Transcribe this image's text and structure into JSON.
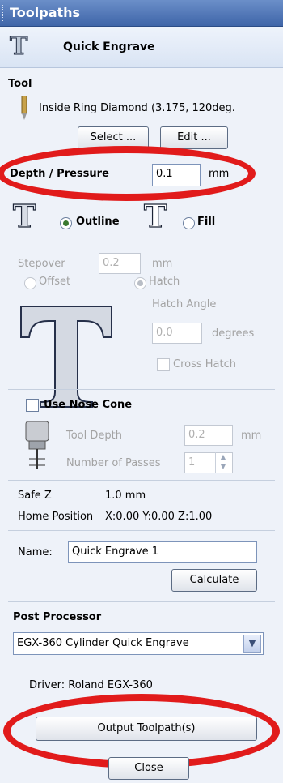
{
  "panel": {
    "title": "Toolpaths"
  },
  "header": {
    "title": "Quick Engrave",
    "icon": "engrave-T-icon"
  },
  "tool": {
    "heading": "Tool",
    "name": "Inside Ring Diamond (3.175, 120deg.",
    "select_label": "Select ...",
    "edit_label": "Edit ..."
  },
  "depth": {
    "label": "Depth / Pressure",
    "value": "0.1",
    "unit": "mm"
  },
  "mode": {
    "outline_label": "Outline",
    "fill_label": "Fill",
    "selected": "Outline"
  },
  "fill_options": {
    "stepover_label": "Stepover",
    "stepover_value": "0.2",
    "stepover_unit": "mm",
    "offset_label": "Offset",
    "hatch_label": "Hatch",
    "hatch_angle_label": "Hatch Angle",
    "hatch_angle_value": "0.0",
    "hatch_angle_unit": "degrees",
    "cross_hatch_label": "Cross Hatch"
  },
  "nose_cone": {
    "label": "Use Nose Cone",
    "tool_depth_label": "Tool Depth",
    "tool_depth_value": "0.2",
    "tool_depth_unit": "mm",
    "passes_label": "Number of Passes",
    "passes_value": "1"
  },
  "positions": {
    "safe_z_label": "Safe Z",
    "safe_z_value": "1.0 mm",
    "home_label": "Home Position",
    "home_value": "X:0.00 Y:0.00 Z:1.00"
  },
  "name_field": {
    "label": "Name:",
    "value": "Quick Engrave 1"
  },
  "calculate_label": "Calculate",
  "post": {
    "heading": "Post Processor",
    "selected": "EGX-360 Cylinder Quick Engrave",
    "driver": "Driver: Roland EGX-360"
  },
  "output_label": "Output Toolpath(s)",
  "close_label": "Close",
  "colors": {
    "title_bar": "#3f65a8",
    "highlight_ring": "#e11b1b",
    "panel_bg": "#eef2f9"
  }
}
